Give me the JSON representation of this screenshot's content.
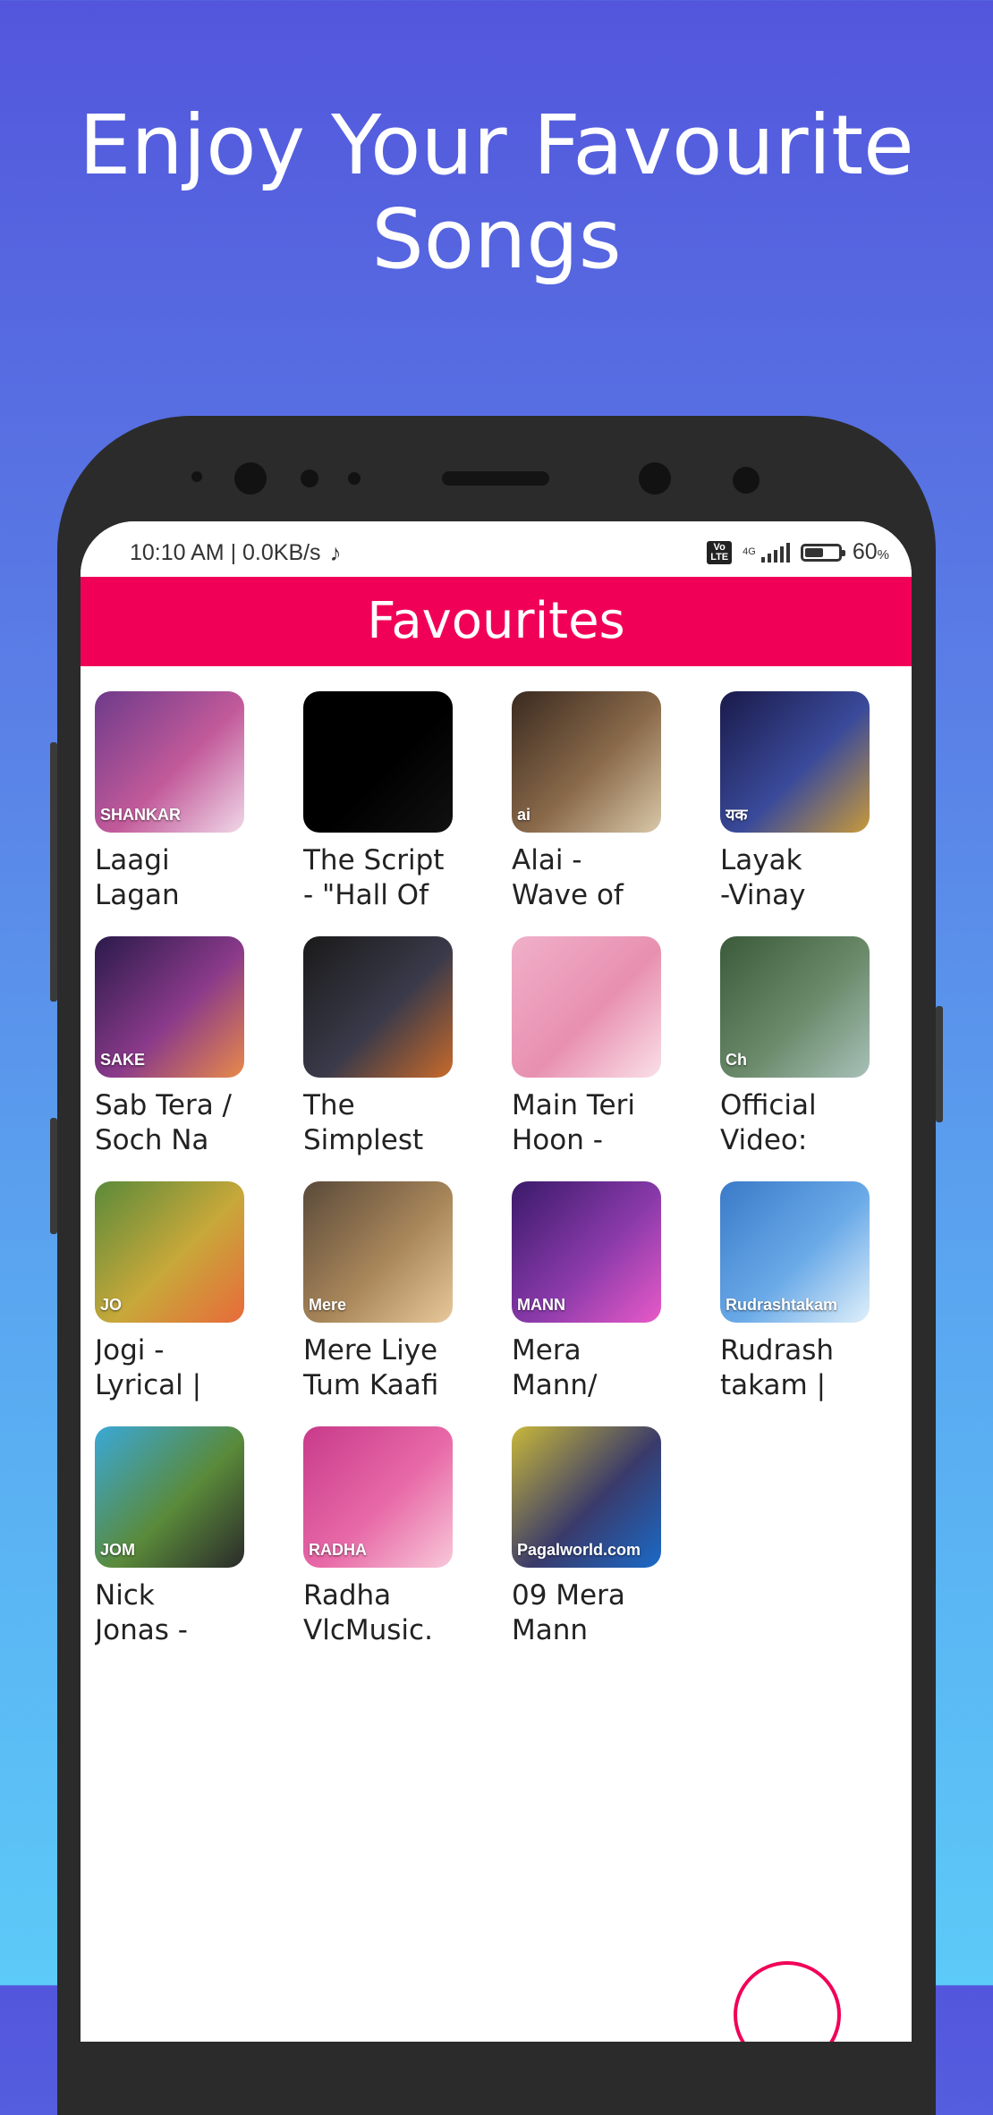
{
  "promo": {
    "line1": "Enjoy Your Favourite",
    "line2": "Songs"
  },
  "status_bar": {
    "time_speed": "10:10 AM | 0.0KB/s",
    "music_icon": "music-note-icon",
    "volte": "Vo LTE",
    "network": "4G",
    "battery_pct": "60",
    "battery_unit": "%",
    "battery_level": 0.6
  },
  "app_bar": {
    "title": "Favourites"
  },
  "songs": [
    {
      "title": "Laagi\nLagan",
      "thumb_text": "SHANKAR",
      "colors": [
        "#6d3a8a",
        "#c25a9a",
        "#f0d8e8"
      ]
    },
    {
      "title": "The Script\n- \"Hall Of",
      "thumb_text": "",
      "colors": [
        "#000000",
        "#000000",
        "#111111"
      ]
    },
    {
      "title": "Alai -\nWave of",
      "thumb_text": "ai",
      "colors": [
        "#3a2a20",
        "#8a6a4a",
        "#d8c8a8"
      ]
    },
    {
      "title": "Layak\n-Vinay",
      "thumb_text": "यक",
      "colors": [
        "#1a1a4a",
        "#3a4a9a",
        "#c89a3a"
      ]
    },
    {
      "title": "Sab Tera /\nSoch Na",
      "thumb_text": "SAKE",
      "colors": [
        "#2a1a4a",
        "#8a3a8a",
        "#e88a4a"
      ]
    },
    {
      "title": "The\nSimplest",
      "thumb_text": "",
      "colors": [
        "#1a1a1a",
        "#3a3a4a",
        "#c86a2a"
      ]
    },
    {
      "title": "Main Teri\nHoon -",
      "thumb_text": "",
      "colors": [
        "#f0b0c8",
        "#e890b0",
        "#fae0e8"
      ]
    },
    {
      "title": "Official\nVideo:",
      "thumb_text": "Ch",
      "colors": [
        "#3a5a3a",
        "#6a8a6a",
        "#a8c0b8"
      ]
    },
    {
      "title": "Jogi -\nLyrical |",
      "thumb_text": "JO",
      "colors": [
        "#5a8a3a",
        "#c8a83a",
        "#e86a3a"
      ]
    },
    {
      "title": "Mere Liye\nTum Kaafi",
      "thumb_text": "Mere",
      "colors": [
        "#5a4a3a",
        "#a8865a",
        "#e8c89a"
      ]
    },
    {
      "title": "Mera\nMann/",
      "thumb_text": "MANN",
      "colors": [
        "#3a1a6a",
        "#8a3aaa",
        "#e85ac8"
      ]
    },
    {
      "title": "Rudrash\ntakam |",
      "thumb_text": "Rudrashtakam",
      "colors": [
        "#3a7ac8",
        "#6aaae8",
        "#e0f0fa"
      ]
    },
    {
      "title": "Nick\nJonas -",
      "thumb_text": "JOM",
      "colors": [
        "#3aa8d8",
        "#5a8a3a",
        "#2a2a2a"
      ]
    },
    {
      "title": "Radha\nVlcMusic.",
      "thumb_text": "RADHA",
      "colors": [
        "#c83a8a",
        "#e86aa8",
        "#f8c8d8"
      ]
    },
    {
      "title": "09 Mera\nMann",
      "thumb_text": "Pagalworld.com",
      "colors": [
        "#c8b83a",
        "#3a3a6a",
        "#1a6ac8"
      ]
    }
  ]
}
